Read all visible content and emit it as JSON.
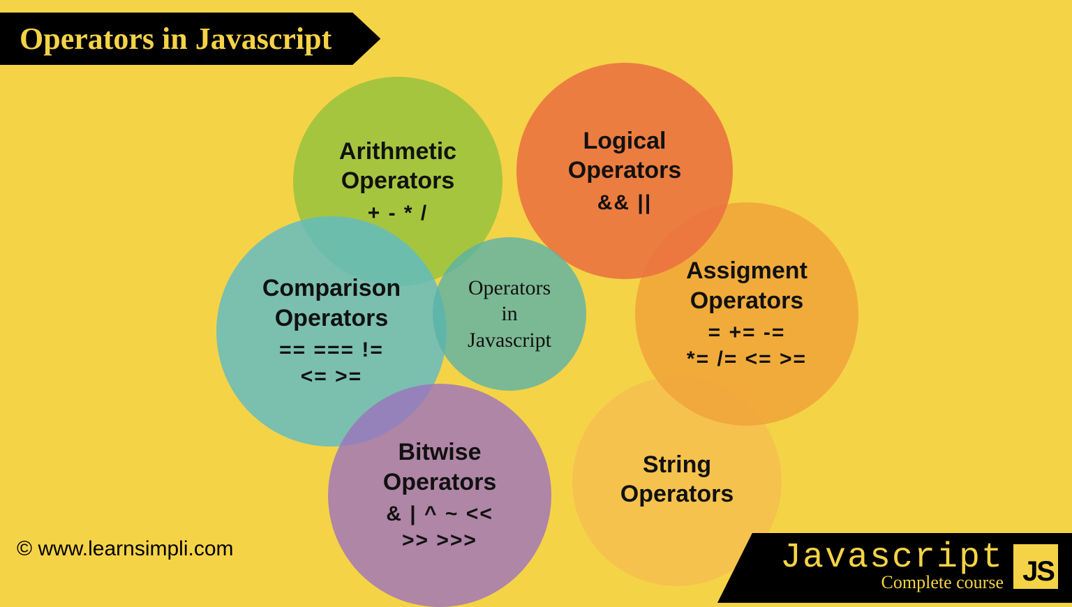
{
  "title": "Operators in Javascript",
  "center": "Operators\nin\nJavascript",
  "bubbles": {
    "arithmetic": {
      "title": "Arithmetic\nOperators",
      "symbols": "+  -  *  /"
    },
    "logical": {
      "title": "Logical\nOperators",
      "symbols": "&&  ||"
    },
    "comparison": {
      "title": "Comparison\nOperators",
      "symbols": "==   ===   !=\n<=  >="
    },
    "assignment": {
      "title": "Assigment\nOperators",
      "symbols": "=   +=   -=\n*=  /=  <=  >="
    },
    "bitwise": {
      "title": "Bitwise\nOperators",
      "symbols": "&  |   ^   ~   <<\n>>  >>>"
    },
    "string": {
      "title": "String\nOperators",
      "symbols": ""
    }
  },
  "colors": {
    "arithmetic": "rgba(152,194,61,0.85)",
    "logical": "rgba(235,113,64,0.88)",
    "comparison": "rgba(96,187,198,0.82)",
    "assignment": "rgba(240,163,58,0.85)",
    "bitwise": "rgba(158,115,190,0.80)",
    "string": "rgba(245,190,80,0.80)",
    "center": "rgba(88,178,170,0.78)"
  },
  "copyright": "© www.learnsimpli.com",
  "footer": {
    "title": "Javascript",
    "subtitle": "Complete course",
    "logo": "JS"
  }
}
